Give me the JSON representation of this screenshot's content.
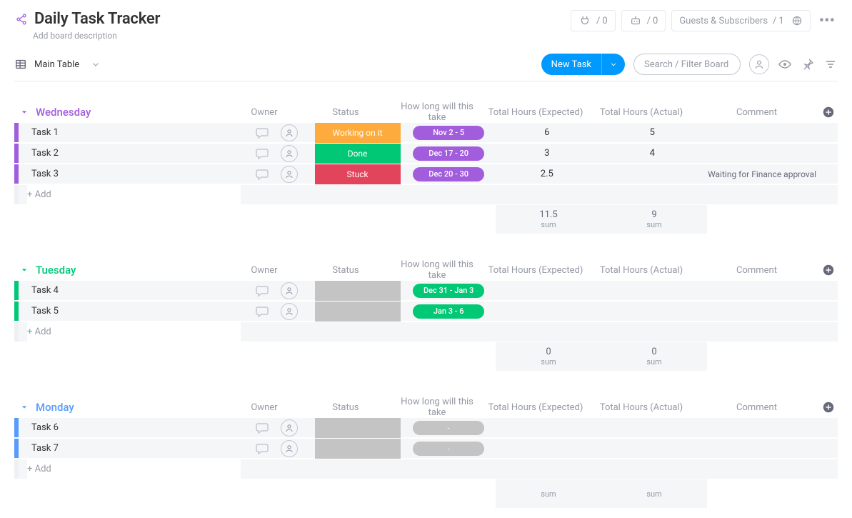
{
  "header": {
    "title": "Daily Task Tracker",
    "description_placeholder": "Add board description",
    "integrations_count": "0",
    "automations_count": "0",
    "guests_label": "Guests & Subscribers",
    "guests_count": "1"
  },
  "viewbar": {
    "view_label": "Main Table",
    "new_task": "New Task",
    "search_placeholder": "Search / Filter Board"
  },
  "columns": {
    "owner": "Owner",
    "status": "Status",
    "timeline": "How long will this take",
    "hours_expected": "Total Hours (Expected)",
    "hours_actual": "Total Hours (Actual)",
    "comment": "Comment"
  },
  "add_row": "+ Add",
  "sum_label": "sum",
  "groups": [
    {
      "id": "wed",
      "name": "Wednesday",
      "color": "#a25ddc",
      "rows": [
        {
          "name": "Task 1",
          "status": {
            "label": "Working on it",
            "color": "#fdab3d"
          },
          "timeline": {
            "label": "Nov 2 - 5",
            "color": "#a25ddc"
          },
          "hours_expected": "6",
          "hours_actual": "5",
          "comment": ""
        },
        {
          "name": "Task 2",
          "status": {
            "label": "Done",
            "color": "#00c875"
          },
          "timeline": {
            "label": "Dec 17 - 20",
            "color": "#a25ddc"
          },
          "hours_expected": "3",
          "hours_actual": "4",
          "comment": ""
        },
        {
          "name": "Task 3",
          "status": {
            "label": "Stuck",
            "color": "#e2445c"
          },
          "timeline": {
            "label": "Dec 20 - 30",
            "color": "#a25ddc"
          },
          "hours_expected": "2.5",
          "hours_actual": "",
          "comment": "Waiting for Finance approval"
        }
      ],
      "sum_expected": "11.5",
      "sum_actual": "9"
    },
    {
      "id": "tue",
      "name": "Tuesday",
      "color": "#00c875",
      "rows": [
        {
          "name": "Task 4",
          "status": null,
          "timeline": {
            "label": "Dec 31 - Jan 3",
            "color": "#00c875"
          },
          "hours_expected": "",
          "hours_actual": "",
          "comment": ""
        },
        {
          "name": "Task 5",
          "status": null,
          "timeline": {
            "label": "Jan 3 - 6",
            "color": "#00c875"
          },
          "hours_expected": "",
          "hours_actual": "",
          "comment": ""
        }
      ],
      "sum_expected": "0",
      "sum_actual": "0"
    },
    {
      "id": "mon",
      "name": "Monday",
      "color": "#579bfc",
      "rows": [
        {
          "name": "Task 6",
          "status": null,
          "timeline": null,
          "hours_expected": "",
          "hours_actual": "",
          "comment": ""
        },
        {
          "name": "Task 7",
          "status": null,
          "timeline": null,
          "hours_expected": "",
          "hours_actual": "",
          "comment": ""
        }
      ],
      "sum_expected": "",
      "sum_actual": ""
    }
  ]
}
